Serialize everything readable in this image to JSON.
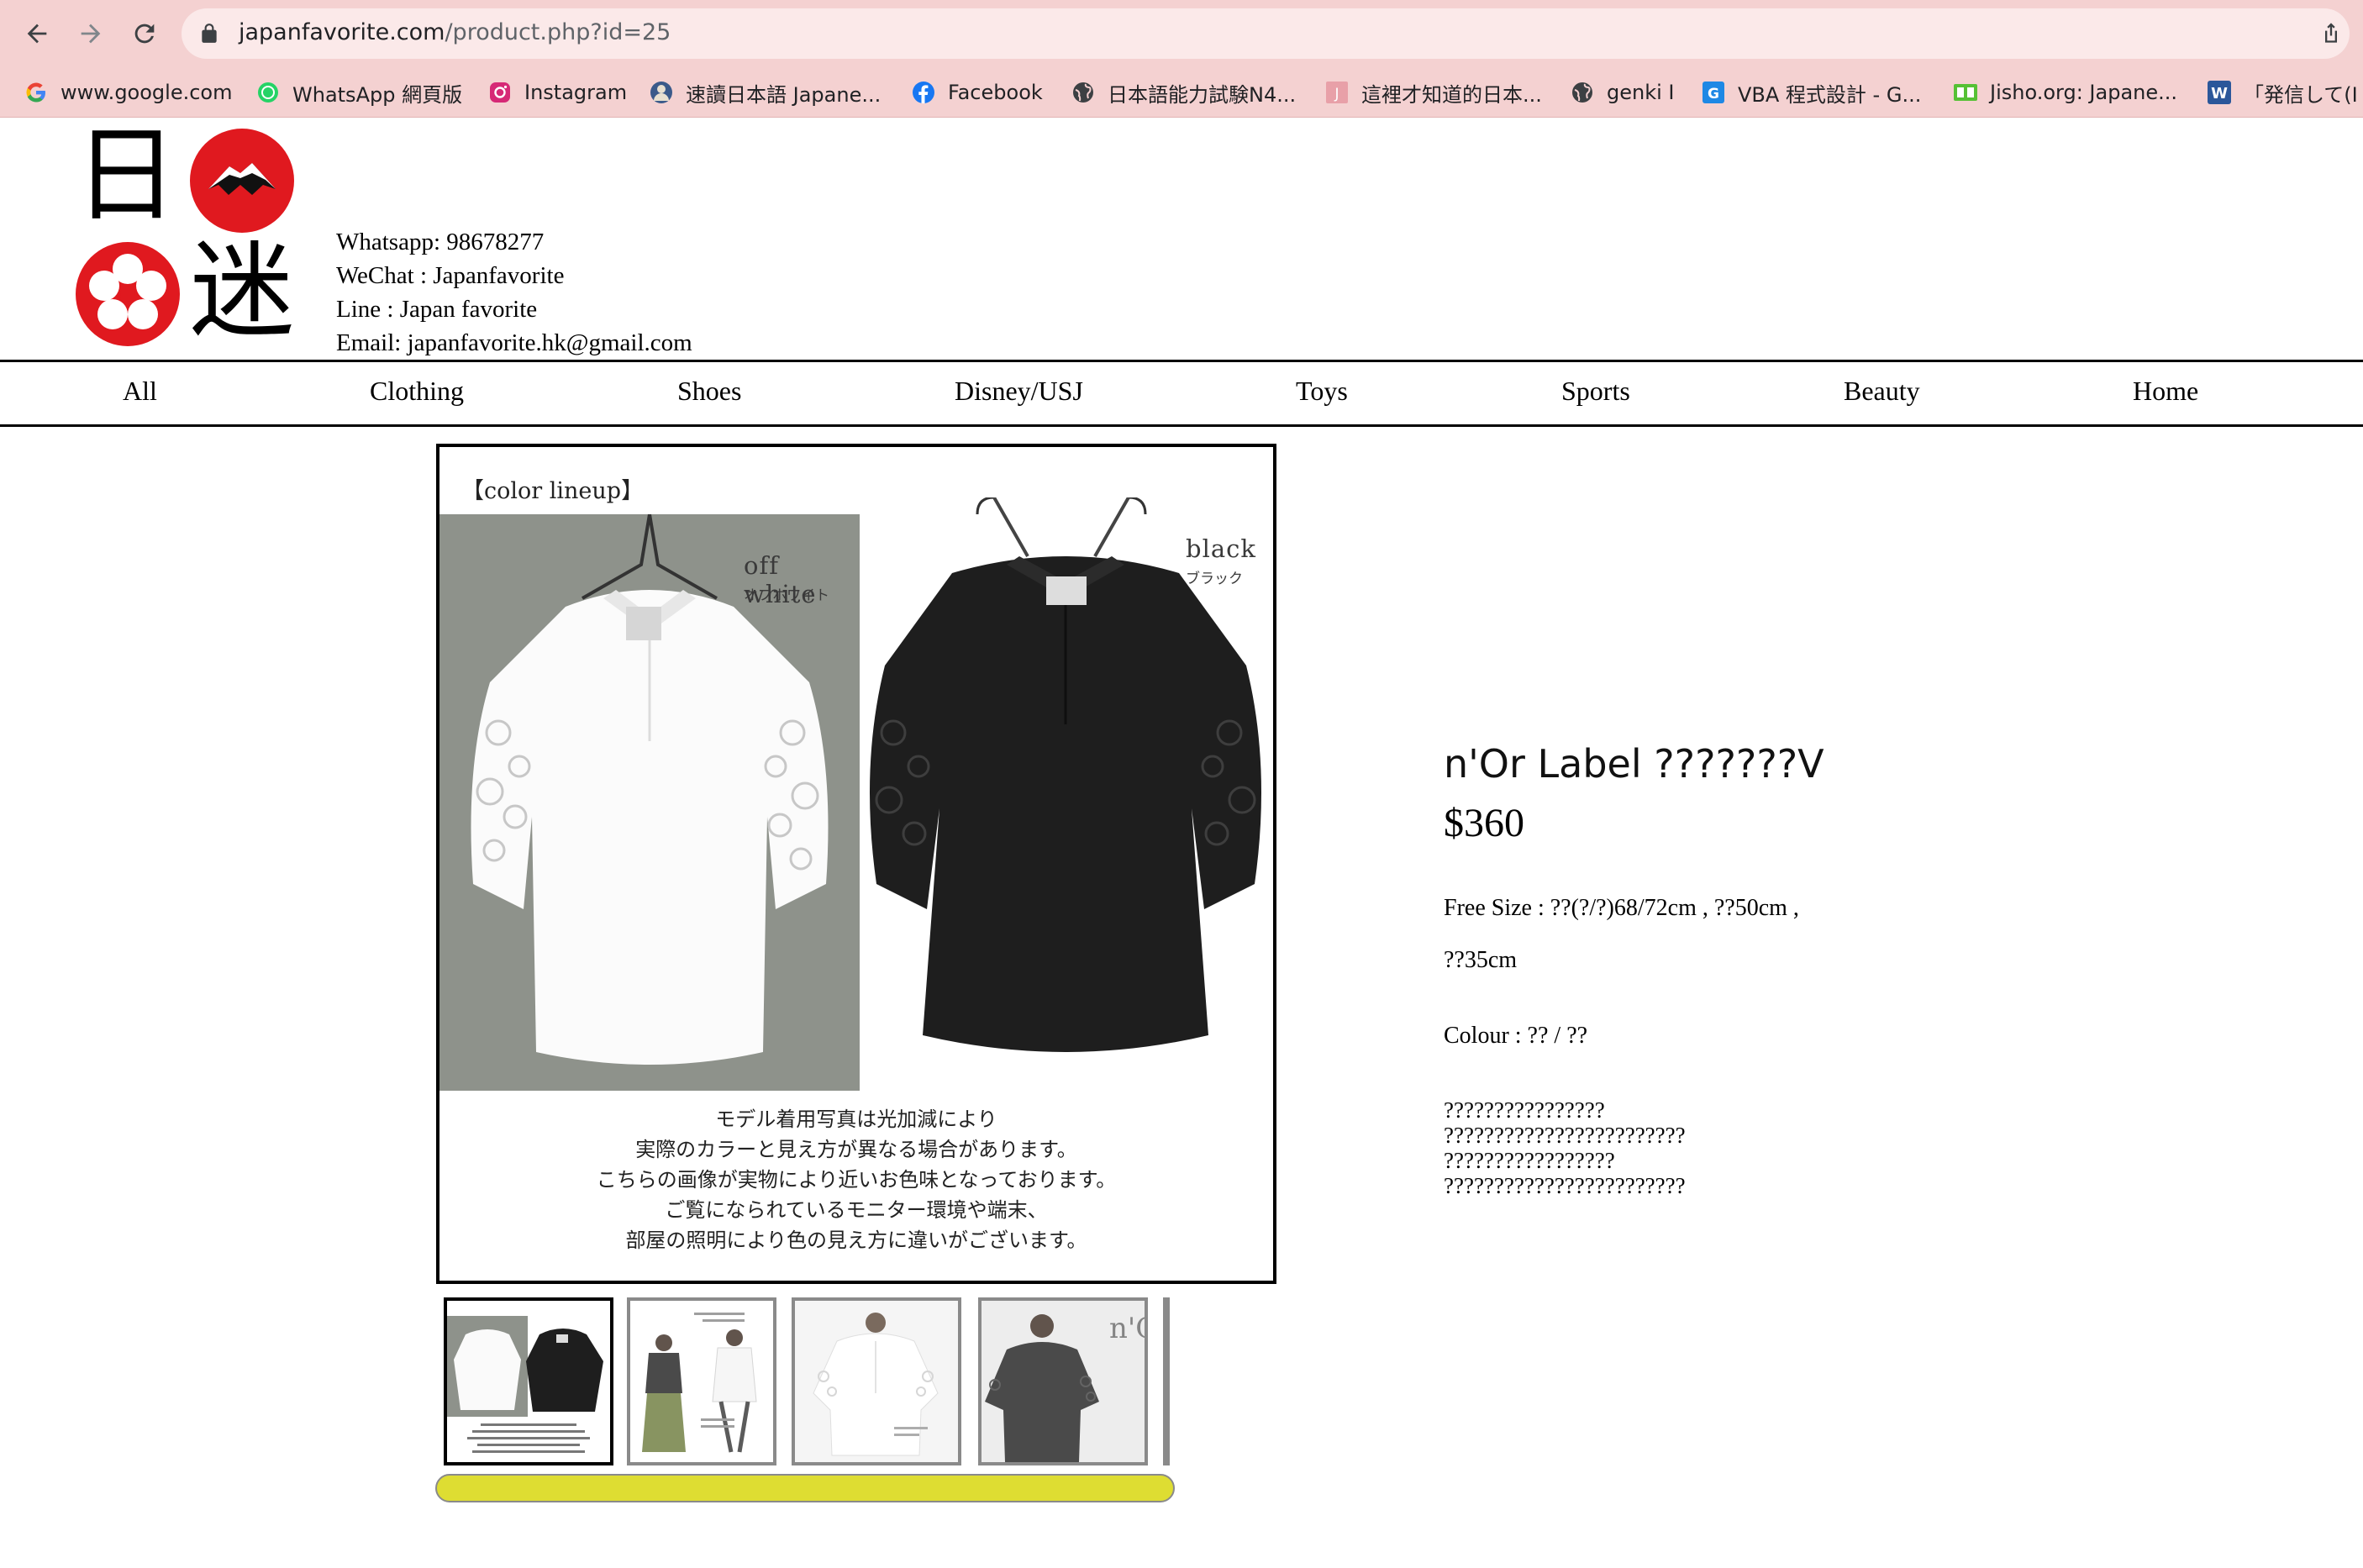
{
  "browser": {
    "url_domain": "japanfavorite.com",
    "url_path": "/product.php?id=25",
    "bookmarks": [
      {
        "label": "www.google.com",
        "icon": "google-icon"
      },
      {
        "label": "WhatsApp 網頁版",
        "icon": "whatsapp-icon"
      },
      {
        "label": "Instagram",
        "icon": "instagram-icon"
      },
      {
        "label": "速讀日本語 Japane...",
        "icon": "globe-avatar-icon"
      },
      {
        "label": "Facebook",
        "icon": "facebook-icon"
      },
      {
        "label": "日本語能力試験N4...",
        "icon": "globe-icon"
      },
      {
        "label": "這裡才知道的日本...",
        "icon": "j-site-icon"
      },
      {
        "label": "genki I",
        "icon": "globe-icon"
      },
      {
        "label": "VBA 程式設計 - G...",
        "icon": "g-site-icon"
      },
      {
        "label": "Jisho.org: Japane...",
        "icon": "jisho-icon"
      },
      {
        "label": "「発信して(I",
        "icon": "word-icon"
      }
    ]
  },
  "site": {
    "logo_chars": [
      "日",
      "迷"
    ],
    "contact": {
      "whatsapp": "Whatsapp: 98678277",
      "wechat": "WeChat : Japanfavorite",
      "line": "Line : Japan favorite",
      "email": "Email: japanfavorite.hk@gmail.com"
    },
    "nav": [
      "All",
      "Clothing",
      "Shoes",
      "Disney/USJ",
      "Toys",
      "Sports",
      "Beauty",
      "Home"
    ]
  },
  "gallery": {
    "lineup_label": "【color lineup】",
    "swatches": [
      {
        "name": "off white",
        "kana": "オフホワイト"
      },
      {
        "name": "black",
        "kana": "ブラック"
      }
    ],
    "caption_lines": [
      "モデル着用写真は光加減により",
      "実際のカラーと見え方が異なる場合があります。",
      "こちらの画像が実物により近いお色味となっております。",
      "ご覧になられているモニター環境や端末、",
      "部屋の照明により色の見え方に違いがございます。"
    ],
    "thumbnail_brand": "n'Or",
    "thumb_count": 4,
    "active_thumb": 0
  },
  "product": {
    "title": "n'Or Label ???????V",
    "price": "$360",
    "size_line1": "Free Size : ??(?/?)68/72cm , ??50cm ,",
    "size_line2": "??35cm",
    "colour": "Colour : ?? / ??",
    "notes": [
      "????????????????",
      "????????????????????????",
      "?????????????????",
      "????????????????????????"
    ]
  },
  "colors": {
    "chrome_bg": "#f4d1d1",
    "omnibox_bg": "#fbe9e9",
    "logo_red": "#e0191f",
    "scrollbar": "#dedd32"
  }
}
